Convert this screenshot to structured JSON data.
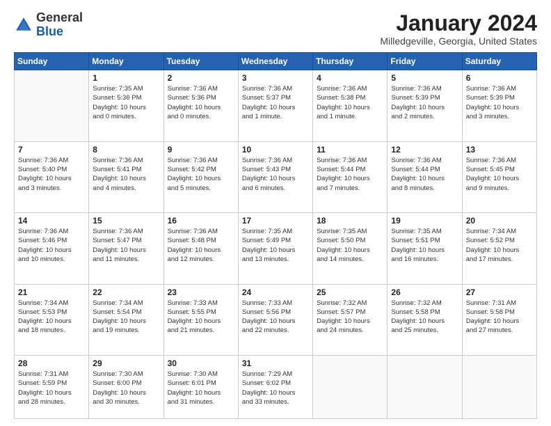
{
  "logo": {
    "general": "General",
    "blue": "Blue"
  },
  "title": {
    "month": "January 2024",
    "location": "Milledgeville, Georgia, United States"
  },
  "weekdays": [
    "Sunday",
    "Monday",
    "Tuesday",
    "Wednesday",
    "Thursday",
    "Friday",
    "Saturday"
  ],
  "weeks": [
    [
      {
        "day": "",
        "info": ""
      },
      {
        "day": "1",
        "info": "Sunrise: 7:35 AM\nSunset: 5:36 PM\nDaylight: 10 hours\nand 0 minutes."
      },
      {
        "day": "2",
        "info": "Sunrise: 7:36 AM\nSunset: 5:36 PM\nDaylight: 10 hours\nand 0 minutes."
      },
      {
        "day": "3",
        "info": "Sunrise: 7:36 AM\nSunset: 5:37 PM\nDaylight: 10 hours\nand 1 minute."
      },
      {
        "day": "4",
        "info": "Sunrise: 7:36 AM\nSunset: 5:38 PM\nDaylight: 10 hours\nand 1 minute."
      },
      {
        "day": "5",
        "info": "Sunrise: 7:36 AM\nSunset: 5:39 PM\nDaylight: 10 hours\nand 2 minutes."
      },
      {
        "day": "6",
        "info": "Sunrise: 7:36 AM\nSunset: 5:39 PM\nDaylight: 10 hours\nand 3 minutes."
      }
    ],
    [
      {
        "day": "7",
        "info": "Sunrise: 7:36 AM\nSunset: 5:40 PM\nDaylight: 10 hours\nand 3 minutes."
      },
      {
        "day": "8",
        "info": "Sunrise: 7:36 AM\nSunset: 5:41 PM\nDaylight: 10 hours\nand 4 minutes."
      },
      {
        "day": "9",
        "info": "Sunrise: 7:36 AM\nSunset: 5:42 PM\nDaylight: 10 hours\nand 5 minutes."
      },
      {
        "day": "10",
        "info": "Sunrise: 7:36 AM\nSunset: 5:43 PM\nDaylight: 10 hours\nand 6 minutes."
      },
      {
        "day": "11",
        "info": "Sunrise: 7:36 AM\nSunset: 5:44 PM\nDaylight: 10 hours\nand 7 minutes."
      },
      {
        "day": "12",
        "info": "Sunrise: 7:36 AM\nSunset: 5:44 PM\nDaylight: 10 hours\nand 8 minutes."
      },
      {
        "day": "13",
        "info": "Sunrise: 7:36 AM\nSunset: 5:45 PM\nDaylight: 10 hours\nand 9 minutes."
      }
    ],
    [
      {
        "day": "14",
        "info": "Sunrise: 7:36 AM\nSunset: 5:46 PM\nDaylight: 10 hours\nand 10 minutes."
      },
      {
        "day": "15",
        "info": "Sunrise: 7:36 AM\nSunset: 5:47 PM\nDaylight: 10 hours\nand 11 minutes."
      },
      {
        "day": "16",
        "info": "Sunrise: 7:36 AM\nSunset: 5:48 PM\nDaylight: 10 hours\nand 12 minutes."
      },
      {
        "day": "17",
        "info": "Sunrise: 7:35 AM\nSunset: 5:49 PM\nDaylight: 10 hours\nand 13 minutes."
      },
      {
        "day": "18",
        "info": "Sunrise: 7:35 AM\nSunset: 5:50 PM\nDaylight: 10 hours\nand 14 minutes."
      },
      {
        "day": "19",
        "info": "Sunrise: 7:35 AM\nSunset: 5:51 PM\nDaylight: 10 hours\nand 16 minutes."
      },
      {
        "day": "20",
        "info": "Sunrise: 7:34 AM\nSunset: 5:52 PM\nDaylight: 10 hours\nand 17 minutes."
      }
    ],
    [
      {
        "day": "21",
        "info": "Sunrise: 7:34 AM\nSunset: 5:53 PM\nDaylight: 10 hours\nand 18 minutes."
      },
      {
        "day": "22",
        "info": "Sunrise: 7:34 AM\nSunset: 5:54 PM\nDaylight: 10 hours\nand 19 minutes."
      },
      {
        "day": "23",
        "info": "Sunrise: 7:33 AM\nSunset: 5:55 PM\nDaylight: 10 hours\nand 21 minutes."
      },
      {
        "day": "24",
        "info": "Sunrise: 7:33 AM\nSunset: 5:56 PM\nDaylight: 10 hours\nand 22 minutes."
      },
      {
        "day": "25",
        "info": "Sunrise: 7:32 AM\nSunset: 5:57 PM\nDaylight: 10 hours\nand 24 minutes."
      },
      {
        "day": "26",
        "info": "Sunrise: 7:32 AM\nSunset: 5:58 PM\nDaylight: 10 hours\nand 25 minutes."
      },
      {
        "day": "27",
        "info": "Sunrise: 7:31 AM\nSunset: 5:58 PM\nDaylight: 10 hours\nand 27 minutes."
      }
    ],
    [
      {
        "day": "28",
        "info": "Sunrise: 7:31 AM\nSunset: 5:59 PM\nDaylight: 10 hours\nand 28 minutes."
      },
      {
        "day": "29",
        "info": "Sunrise: 7:30 AM\nSunset: 6:00 PM\nDaylight: 10 hours\nand 30 minutes."
      },
      {
        "day": "30",
        "info": "Sunrise: 7:30 AM\nSunset: 6:01 PM\nDaylight: 10 hours\nand 31 minutes."
      },
      {
        "day": "31",
        "info": "Sunrise: 7:29 AM\nSunset: 6:02 PM\nDaylight: 10 hours\nand 33 minutes."
      },
      {
        "day": "",
        "info": ""
      },
      {
        "day": "",
        "info": ""
      },
      {
        "day": "",
        "info": ""
      }
    ]
  ]
}
